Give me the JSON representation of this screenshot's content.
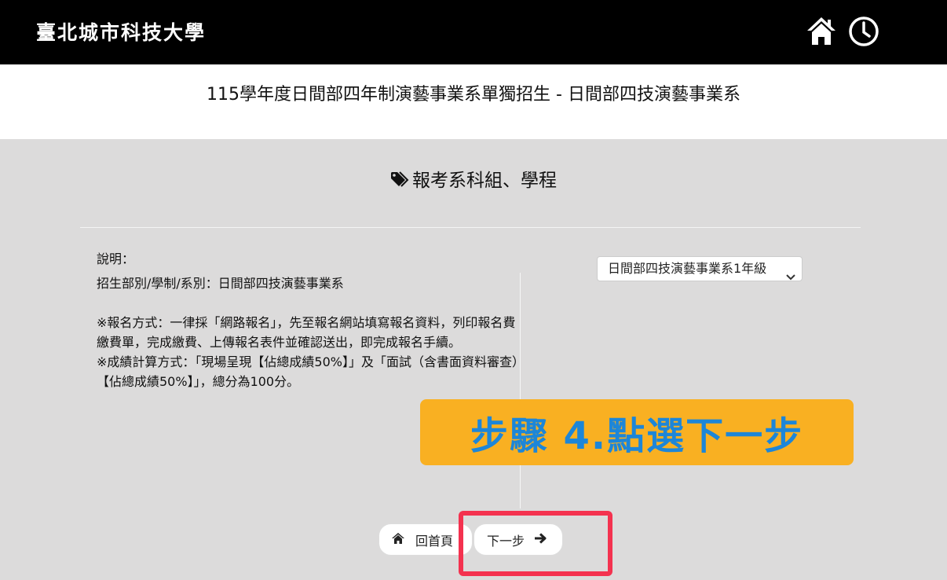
{
  "header": {
    "brand": "臺北城市科技大學",
    "icons": [
      "home-icon",
      "clock-icon"
    ]
  },
  "page_title": "115學年度日間部四年制演藝事業系單獨招生 - 日間部四技演藝事業系",
  "section": {
    "heading": "報考系科組、學程",
    "icon": "tag-icon"
  },
  "description": {
    "title": "說明：",
    "line_dept": "招生部別/學制/系別：日間部四技演藝事業系",
    "line_method": "※報名方式：一律採「網路報名」，先至報名網站填寫報名資料，列印報名費繳費單，完成繳費、上傳報名表件並確認送出，即完成報名手續。",
    "line_score": "※成績計算方式：「現場呈現【佔總成績50%】」及「面試（含書面資料審查）【佔總成績50%】」，總分為100分。"
  },
  "select": {
    "value": "日間部四技演藝事業系1年級"
  },
  "overlay": {
    "text": "步驟 4.點選下一步"
  },
  "buttons": {
    "home_label": "回首頁",
    "next_label": "下一步"
  },
  "colors": {
    "banner_bg": "#f9b022",
    "banner_text": "#1d86d8",
    "highlight": "#f4324f"
  }
}
